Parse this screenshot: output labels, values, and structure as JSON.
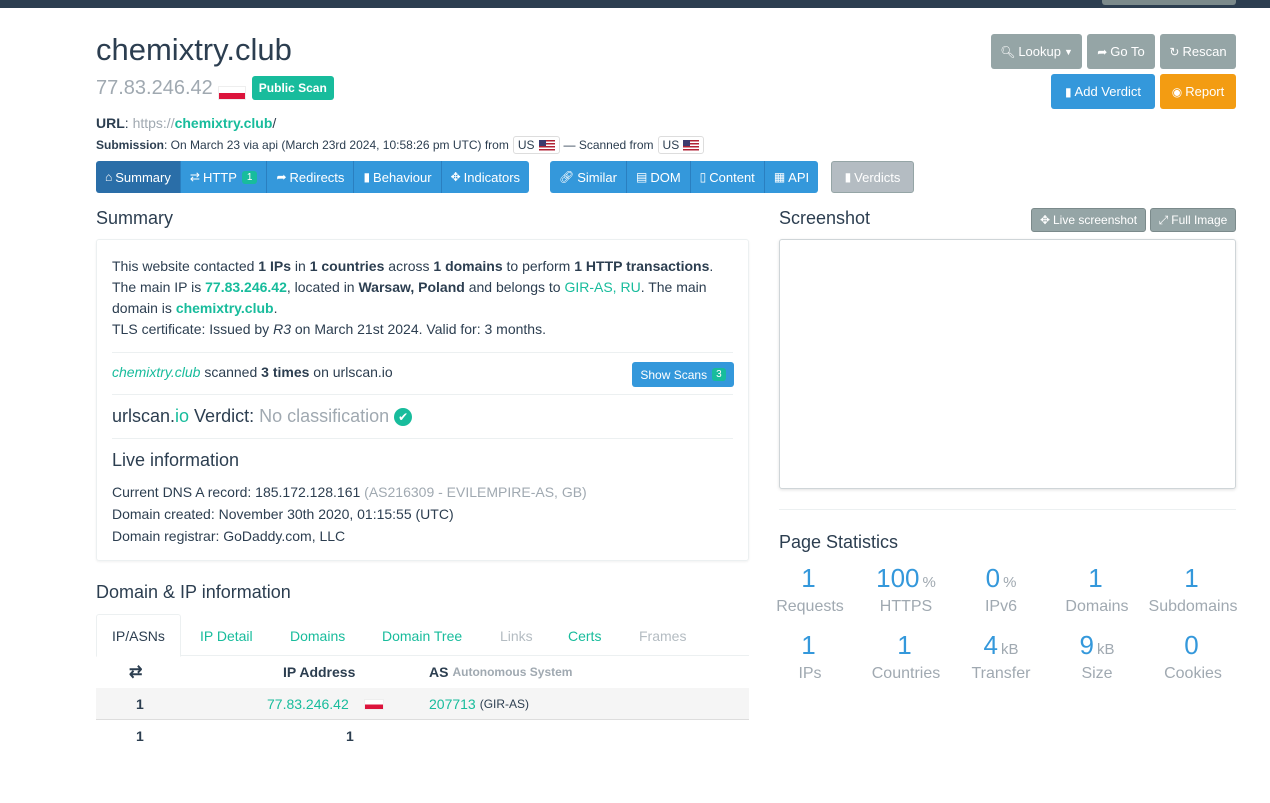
{
  "header": {
    "domain": "chemixtry.club",
    "ip": "77.83.246.42",
    "public_badge": "Public Scan",
    "url_label": "URL",
    "url_scheme": "https://",
    "url_host": "chemixtry.club",
    "url_path": "/",
    "submission_label": "Submission",
    "submission_text": ": On March 23 via api (March 23rd 2024, 10:58:26 pm UTC) from",
    "from_country": "US",
    "scanned_from_text": "— Scanned from",
    "scanned_country": "US"
  },
  "actions": {
    "lookup": "Lookup",
    "goto": "Go To",
    "rescan": "Rescan",
    "add_verdict": "Add Verdict",
    "report": "Report"
  },
  "tabs": {
    "summary": "Summary",
    "http": "HTTP",
    "http_count": "1",
    "redirects": "Redirects",
    "behaviour": "Behaviour",
    "indicators": "Indicators",
    "similar": "Similar",
    "dom": "DOM",
    "content": "Content",
    "api": "API",
    "verdicts": "Verdicts"
  },
  "summary": {
    "heading": "Summary",
    "l1_a": "This website contacted ",
    "l1_ips": "1 IPs",
    "l1_b": " in ",
    "l1_countries": "1 countries",
    "l1_c": " across ",
    "l1_domains": "1 domains",
    "l1_d": " to perform ",
    "l1_http": "1 HTTP transactions",
    "l1_e": ".",
    "l2_a": "The main IP is ",
    "l2_ip": "77.83.246.42",
    "l2_b": ", located in ",
    "l2_loc": "Warsaw, Poland",
    "l2_c": " and belongs to ",
    "l2_as": "GIR-AS, RU",
    "l2_d": ". The main",
    "l3_a": "domain is ",
    "l3_domain": "chemixtry.club",
    "l3_b": ".",
    "tls_a": "TLS certificate: Issued by ",
    "tls_issuer": "R3",
    "tls_b": " on March 21st 2024. Valid for: 3 months.",
    "scanned_domain": "chemixtry.club",
    "scanned_a": " scanned ",
    "scanned_times": "3 times",
    "scanned_b": " on urlscan.io",
    "show_scans": "Show Scans",
    "show_scans_count": "3",
    "verdict_brand_a": "urlscan.",
    "verdict_brand_b": "io",
    "verdict_label": " Verdict: ",
    "verdict_value": "No classification",
    "live_heading": "Live information",
    "dns_a": "Current DNS A record: 185.172.128.161 ",
    "dns_as": "(AS216309 - EVILEMPIRE-AS, GB)",
    "created": "Domain created: November 30th 2020, 01:15:55 (UTC)",
    "registrar": "Domain registrar: GoDaddy.com, LLC"
  },
  "domain_ip": {
    "heading": "Domain & IP information",
    "tabs": [
      "IP/ASNs",
      "IP Detail",
      "Domains",
      "Domain Tree",
      "Links",
      "Certs",
      "Frames"
    ],
    "col_ip": "IP Address",
    "col_as": "AS",
    "col_as_sub": "Autonomous System",
    "row_count": "1",
    "row_ip": "77.83.246.42",
    "row_asn": "207713",
    "row_asname": "(GIR-AS)",
    "total_count": "1",
    "total_ips": "1"
  },
  "screenshot": {
    "heading": "Screenshot",
    "live": "Live screenshot",
    "full": "Full Image"
  },
  "stats": {
    "heading": "Page Statistics",
    "items": [
      {
        "num": "1",
        "unit": "",
        "label": "Requests"
      },
      {
        "num": "100",
        "unit": "%",
        "label": "HTTPS"
      },
      {
        "num": "0",
        "unit": "%",
        "label": "IPv6"
      },
      {
        "num": "1",
        "unit": "",
        "label": "Domains"
      },
      {
        "num": "1",
        "unit": "",
        "label": "Subdomains"
      },
      {
        "num": "1",
        "unit": "",
        "label": "IPs"
      },
      {
        "num": "1",
        "unit": "",
        "label": "Countries"
      },
      {
        "num": "4",
        "unit": "kB",
        "label": "Transfer"
      },
      {
        "num": "9",
        "unit": "kB",
        "label": "Size"
      },
      {
        "num": "0",
        "unit": "",
        "label": "Cookies"
      }
    ]
  },
  "colors": {
    "primary": "#2c3e50",
    "success": "#18bc9c",
    "info": "#3498db",
    "warning": "#f39c12",
    "muted": "#95a5a6"
  }
}
